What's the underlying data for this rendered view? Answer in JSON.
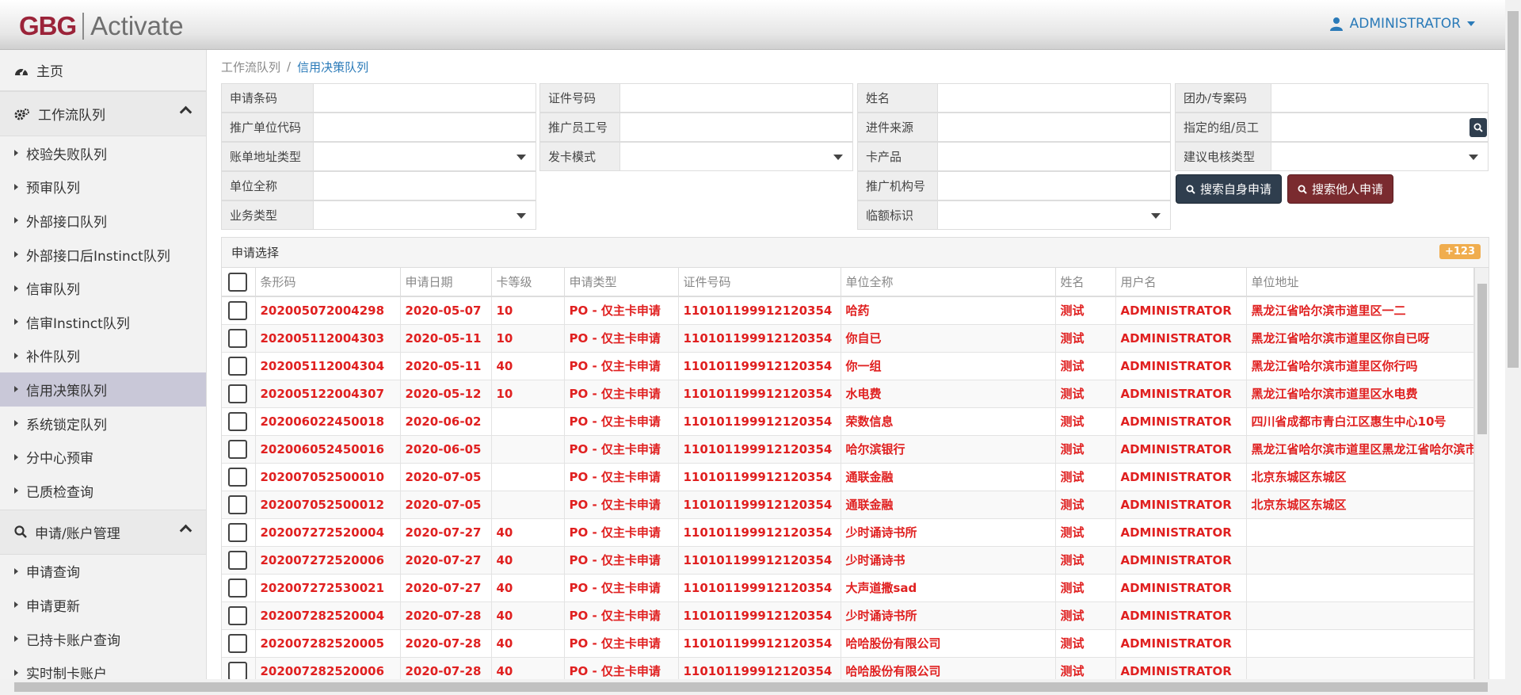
{
  "header": {
    "logo_brand": "GBG",
    "logo_product": "Activate",
    "user_name": "ADMINISTRATOR"
  },
  "sidebar": {
    "home": "主页",
    "section1": "工作流队列",
    "items1": [
      "校验失败队列",
      "预审队列",
      "外部接口队列",
      "外部接口后Instinct队列",
      "信审队列",
      "信审Instinct队列",
      "补件队列",
      "信用决策队列",
      "系统锁定队列",
      "分中心预审",
      "已质检查询"
    ],
    "active_item": "信用决策队列",
    "section2": "申请/账户管理",
    "items2": [
      "申请查询",
      "申请更新",
      "已持卡账户查询",
      "实时制卡账户"
    ]
  },
  "breadcrumb": {
    "parent": "工作流队列",
    "sep": "/",
    "current": "信用决策队列"
  },
  "form": {
    "app_barcode": "申请条码",
    "id_number": "证件号码",
    "name": "姓名",
    "group_code": "团办/专案码",
    "promo_unit_code": "推广单位代码",
    "promoter_id": "推广员工号",
    "source": "进件来源",
    "assigned_group": "指定的组/员工",
    "bill_addr_type": "账单地址类型",
    "card_issue_mode": "发卡模式",
    "card_product": "卡产品",
    "suggest_check_type": "建议电核类型",
    "company_name": "单位全称",
    "promo_org": "推广机构号",
    "business_type": "业务类型",
    "temp_limit": "临额标识",
    "btn_search_self": "搜索自身申请",
    "btn_search_others": "搜索他人申请"
  },
  "table": {
    "title": "申请选择",
    "badge": "+123",
    "headers": [
      "条形码",
      "申请日期",
      "卡等级",
      "申请类型",
      "证件号码",
      "单位全称",
      "姓名",
      "用户名",
      "单位地址"
    ],
    "rows": [
      [
        "202005072004298",
        "2020-05-07",
        "10",
        "PO - 仅主卡申请",
        "110101199912120354",
        "哈药",
        "测试",
        "ADMINISTRATOR",
        "黑龙江省哈尔滨市道里区一二"
      ],
      [
        "202005112004303",
        "2020-05-11",
        "10",
        "PO - 仅主卡申请",
        "110101199912120354",
        "你自已",
        "测试",
        "ADMINISTRATOR",
        "黑龙江省哈尔滨市道里区你自已呀"
      ],
      [
        "202005112004304",
        "2020-05-11",
        "40",
        "PO - 仅主卡申请",
        "110101199912120354",
        "你一组",
        "测试",
        "ADMINISTRATOR",
        "黑龙江省哈尔滨市道里区你行吗"
      ],
      [
        "202005122004307",
        "2020-05-12",
        "10",
        "PO - 仅主卡申请",
        "110101199912120354",
        "水电费",
        "测试",
        "ADMINISTRATOR",
        "黑龙江省哈尔滨市道里区水电费"
      ],
      [
        "202006022450018",
        "2020-06-02",
        "",
        "PO - 仅主卡申请",
        "110101199912120354",
        "荣数信息",
        "测试",
        "ADMINISTRATOR",
        "四川省成都市青白江区惠生中心10号"
      ],
      [
        "202006052450016",
        "2020-06-05",
        "",
        "PO - 仅主卡申请",
        "110101199912120354",
        "哈尔滨银行",
        "测试",
        "ADMINISTRATOR",
        "黑龙江省哈尔滨市道里区黑龙江省哈尔滨市"
      ],
      [
        "202007052500010",
        "2020-07-05",
        "",
        "PO - 仅主卡申请",
        "110101199912120354",
        "通联金融",
        "测试",
        "ADMINISTRATOR",
        "北京东城区东城区"
      ],
      [
        "202007052500012",
        "2020-07-05",
        "",
        "PO - 仅主卡申请",
        "110101199912120354",
        "通联金融",
        "测试",
        "ADMINISTRATOR",
        "北京东城区东城区"
      ],
      [
        "202007272520004",
        "2020-07-27",
        "40",
        "PO - 仅主卡申请",
        "110101199912120354",
        "少时诵诗书所",
        "测试",
        "ADMINISTRATOR",
        ""
      ],
      [
        "202007272520006",
        "2020-07-27",
        "40",
        "PO - 仅主卡申请",
        "110101199912120354",
        "少时诵诗书",
        "测试",
        "ADMINISTRATOR",
        ""
      ],
      [
        "202007272530021",
        "2020-07-27",
        "40",
        "PO - 仅主卡申请",
        "110101199912120354",
        "大声道撒sad",
        "测试",
        "ADMINISTRATOR",
        ""
      ],
      [
        "202007282520004",
        "2020-07-28",
        "40",
        "PO - 仅主卡申请",
        "110101199912120354",
        "少时诵诗书所",
        "测试",
        "ADMINISTRATOR",
        ""
      ],
      [
        "202007282520005",
        "2020-07-28",
        "40",
        "PO - 仅主卡申请",
        "110101199912120354",
        "哈哈股份有限公司",
        "测试",
        "ADMINISTRATOR",
        ""
      ],
      [
        "202007282520006",
        "2020-07-28",
        "40",
        "PO - 仅主卡申请",
        "110101199912120354",
        "哈哈股份有限公司",
        "测试",
        "ADMINISTRATOR",
        ""
      ]
    ]
  }
}
